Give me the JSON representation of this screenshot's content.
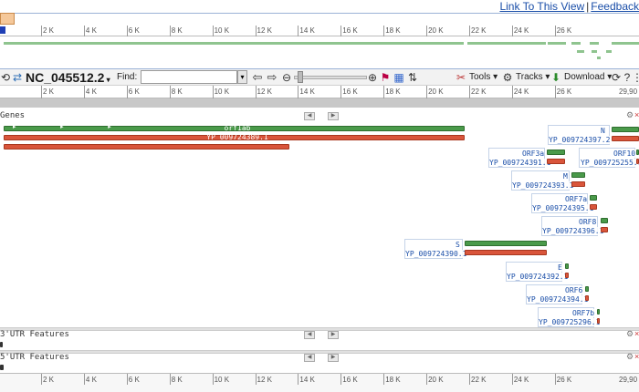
{
  "header": {
    "link_view": "Link To This View",
    "link_sep": "|",
    "link_feedback": "Feedback"
  },
  "ruler": {
    "labels": [
      "2 K",
      "4 K",
      "6 K",
      "8 K",
      "10 K",
      "12 K",
      "14 K",
      "16 K",
      "18 K",
      "20 K",
      "22 K",
      "24 K",
      "26 K"
    ],
    "end_label": "29,90"
  },
  "toolbar": {
    "accession": "NC_045512.2",
    "find_label": "Find:",
    "find_value": "",
    "tools_label": "Tools",
    "tracks_label": "Tracks",
    "download_label": "Download"
  },
  "tracks": {
    "genes": {
      "title": "Genes"
    },
    "utr3": {
      "title": "3'UTR Features"
    },
    "utr5": {
      "title": "5'UTR Features"
    }
  },
  "features": {
    "orf1ab_label": "orf1ab",
    "orf1ab_cds": "YP_009724389.1",
    "n_gene": "N",
    "n_cds": "YP_009724397.2",
    "orf3a_gene": "ORF3a",
    "orf3a_cds": "YP_009724391.1",
    "orf10_gene": "ORF10",
    "orf10_cds": "YP_009725255.1",
    "m_gene": "M",
    "m_cds": "YP_009724393.1",
    "orf7a_gene": "ORF7a",
    "orf7a_cds": "YP_009724395.1",
    "orf8_gene": "ORF8",
    "orf8_cds": "YP_009724396.1",
    "s_gene": "S",
    "s_cds": "YP_009724390.1",
    "e_gene": "E",
    "e_cds": "YP_009724392.1",
    "orf6_gene": "ORF6",
    "orf6_cds": "YP_009724394.1",
    "orf7b_gene": "ORF7b",
    "orf7b_cds": "YP_009725296.1"
  },
  "colors": {
    "gene": "#4a9a4a",
    "cds": "#d9553b",
    "link": "#1a4ea8"
  }
}
